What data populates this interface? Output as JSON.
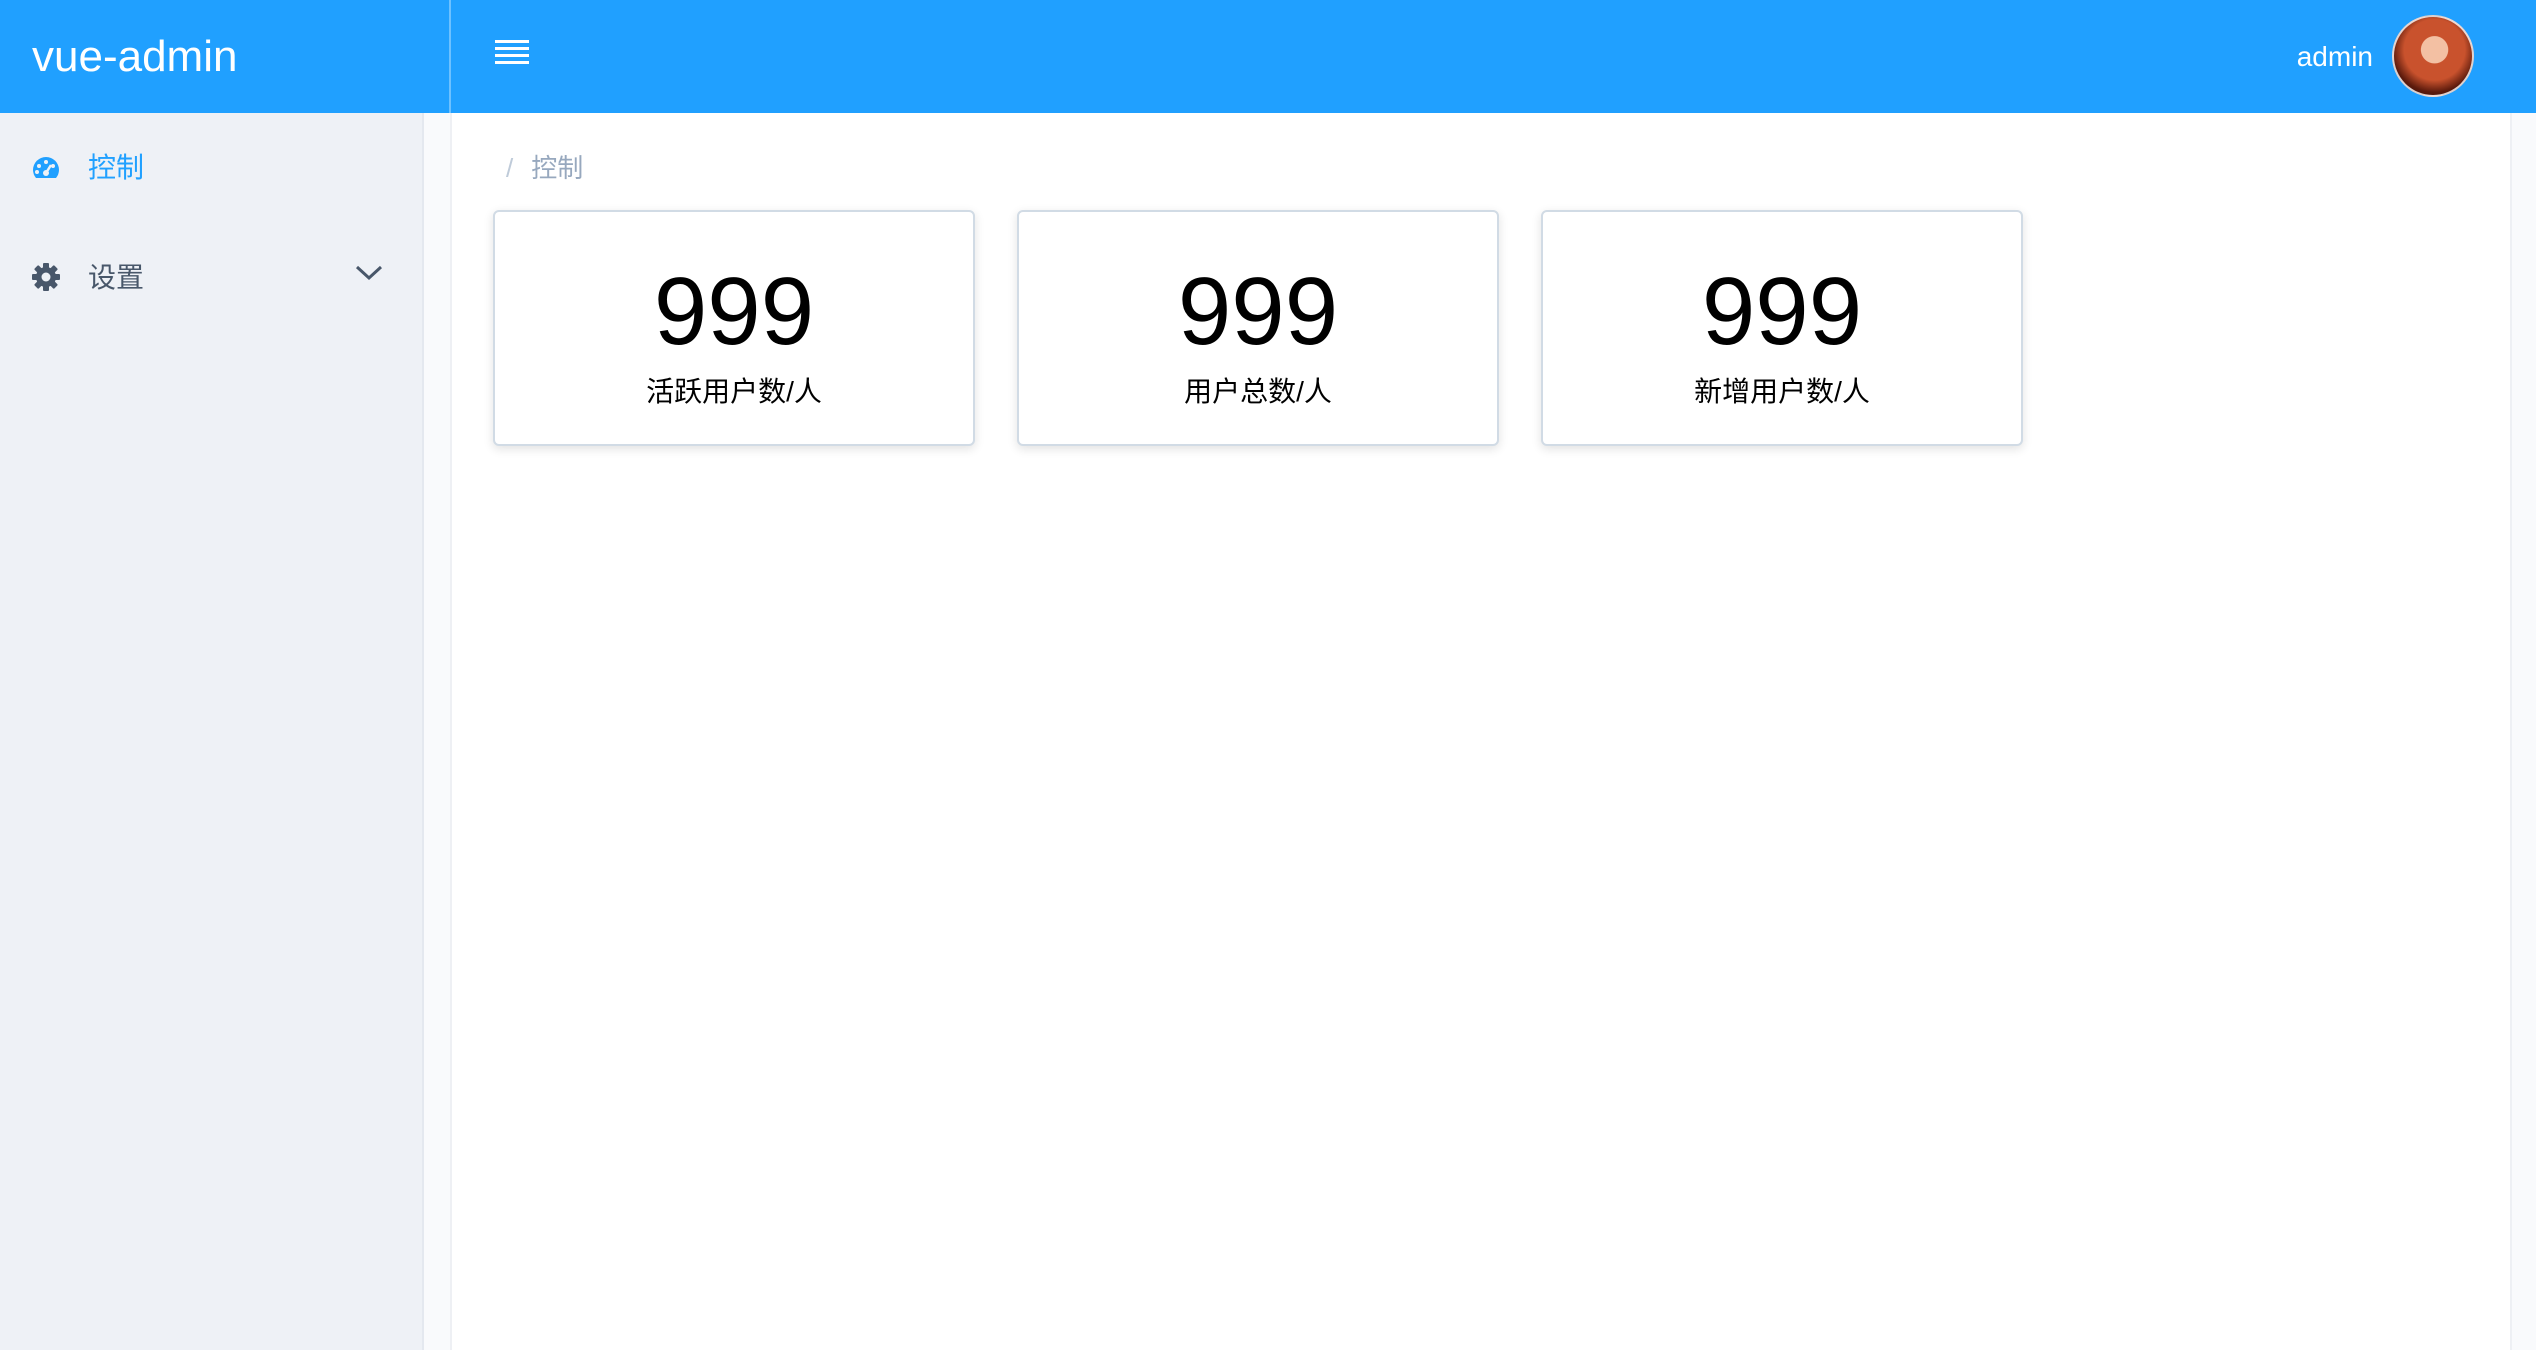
{
  "header": {
    "brand": "vue-admin",
    "menu_toggle_icon": "hamburger-icon",
    "username": "admin",
    "accent_color": "#20a0ff"
  },
  "sidebar": {
    "items": [
      {
        "label": "控制",
        "icon": "dashboard-icon",
        "active": true
      },
      {
        "label": "设置",
        "icon": "gear-icon",
        "expandable": true
      }
    ]
  },
  "breadcrumb": {
    "separator": "/",
    "current": "控制"
  },
  "stats": [
    {
      "value": "999",
      "label": "活跃用户数/人"
    },
    {
      "value": "999",
      "label": "用户总数/人"
    },
    {
      "value": "999",
      "label": "新增用户数/人"
    }
  ]
}
